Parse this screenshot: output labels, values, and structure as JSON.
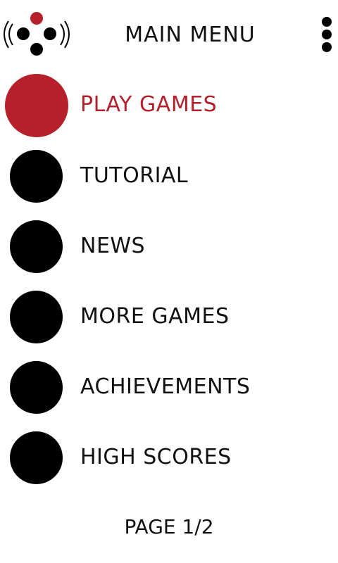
{
  "header": {
    "title": "MAIN MENU",
    "logo_icon": "gamepad-signal-icon",
    "menu_icon": "vertical-ellipsis-icon"
  },
  "colors": {
    "accent": "#b5202b",
    "bullet": "#000000",
    "text": "#111111",
    "background": "#ffffff"
  },
  "menu": {
    "items": [
      {
        "label": "PLAY GAMES",
        "active": true
      },
      {
        "label": "TUTORIAL",
        "active": false
      },
      {
        "label": "NEWS",
        "active": false
      },
      {
        "label": "MORE GAMES",
        "active": false
      },
      {
        "label": "ACHIEVEMENTS",
        "active": false
      },
      {
        "label": "HIGH SCORES",
        "active": false
      }
    ]
  },
  "footer": {
    "page_indicator": "PAGE 1/2"
  }
}
